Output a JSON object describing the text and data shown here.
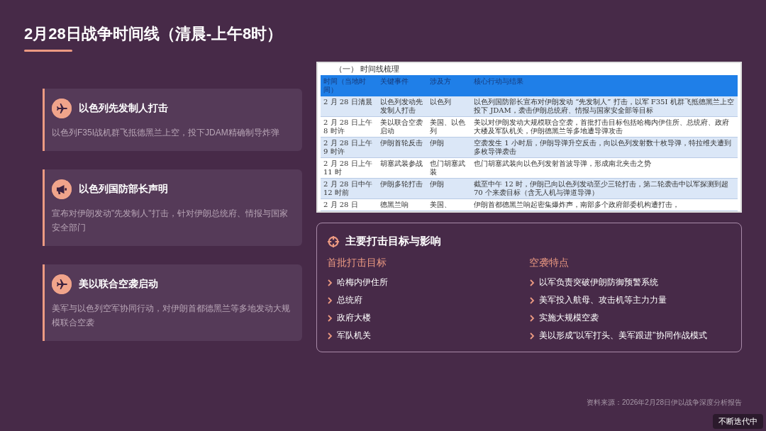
{
  "title": "2月28日战争时间线（清晨-上午8时）",
  "events": [
    {
      "kind": "plane",
      "title": "以色列先发制人打击",
      "desc": "以色列F35I战机群飞抵德黑兰上空，投下JDAM精确制导炸弹"
    },
    {
      "kind": "megaphone",
      "title": "以色列国防部长声明",
      "desc": "宣布对伊朗发动\"先发制人\"打击，针对伊朗总统府、情报与国家安全部门"
    },
    {
      "kind": "plane",
      "title": "美以联合空袭启动",
      "desc": "美军与以色列空军协同行动，对伊朗首都德黑兰等多地发动大规模联合空袭"
    }
  ],
  "document": {
    "heading": "（一） 时间线梳理",
    "columns": [
      "时间（当地时间）",
      "关键事件",
      "涉及方",
      "核心行动与结果"
    ],
    "rows": [
      [
        "2 月 28 日清晨",
        "以色列发动先发制人打击",
        "以色列",
        "以色列国防部长宣布对伊朗发动 “先发制人” 打击，以军 F35I 机群飞抵德黑兰上空投下 JDAM，袭击伊朗总统府、情报与国家安全部等目标"
      ],
      [
        "2 月 28 日上午 8 时许",
        "美以联合空袭启动",
        "美国、以色列",
        "美以对伊朗发动大规模联合空袭，首批打击目标包括哈梅内伊住所、总统府、政府大楼及军队机关，伊朗德黑兰等多地遭导弹攻击"
      ],
      [
        "2 月 28 日上午 9 时许",
        "伊朗首轮反击",
        "伊朗",
        "空袭发生 1 小时后，伊朗导弹升空反击，向以色列发射数十枚导弹，特拉维夫遭到多枚导弹袭击"
      ],
      [
        "2 月 28 日上午 11 时",
        "胡塞武装参战",
        "也门胡塞武装",
        "也门胡塞武装向以色列发射首波导弹，形成南北夹击之势"
      ],
      [
        "2 月 28 日中午 12 时前",
        "伊朗多轮打击",
        "伊朗",
        "截至中午 12 时，伊朗已向以色列发动至少三轮打击，第二轮袭击中以军探测到超 70 个来袭目标（含无人机与弹道导弹）"
      ],
      [
        "2 月 28 日",
        "德黑兰响",
        "美国、",
        "伊朗首都德黑兰响起密集爆炸声，南部多个政府部委机构遭打击，"
      ]
    ]
  },
  "targets_card": {
    "title": "主要打击目标与影响",
    "groups": [
      {
        "heading": "首批打击目标",
        "items": [
          "哈梅内伊住所",
          "总统府",
          "政府大楼",
          "军队机关"
        ]
      },
      {
        "heading": "空袭特点",
        "items": [
          "以军负责突破伊朗防御预警系统",
          "美军投入航母、攻击机等主力力量",
          "实施大规模空袭",
          "美以形成\"以军打头、美军跟进\"协同作战模式"
        ]
      }
    ]
  },
  "source": "资料来源：2026年2月28日伊以战争深度分析报告",
  "badge": "不断迭代中"
}
